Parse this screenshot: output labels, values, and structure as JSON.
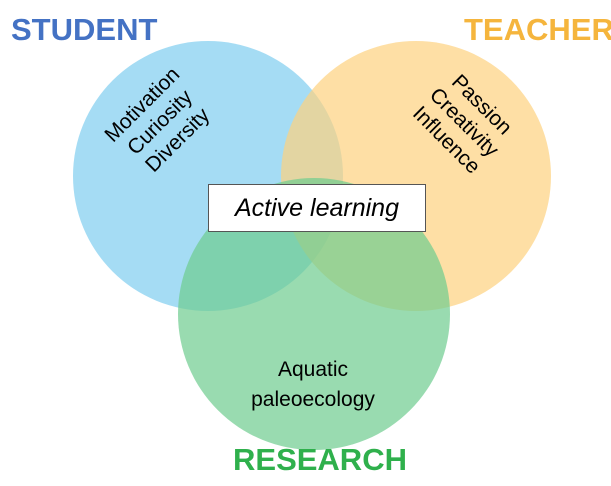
{
  "diagram": {
    "type": "venn",
    "colors": {
      "student": "#7fcdf0",
      "teacher": "#fdd27f",
      "research": "#6dcc8e",
      "student_title": "#4472c4",
      "teacher_title": "#f5b53d",
      "research_title": "#2fb04c"
    },
    "sets": {
      "student": {
        "title": "STUDENT",
        "traits": [
          "Motivation",
          "Curiosity",
          "Diversity"
        ]
      },
      "teacher": {
        "title": "TEACHER",
        "traits": [
          "Passion",
          "Creativity",
          "Influence"
        ]
      },
      "research": {
        "title": "RESEARCH",
        "topic": [
          "Aquatic",
          "paleoecology"
        ]
      }
    },
    "center_label": "Active learning"
  }
}
